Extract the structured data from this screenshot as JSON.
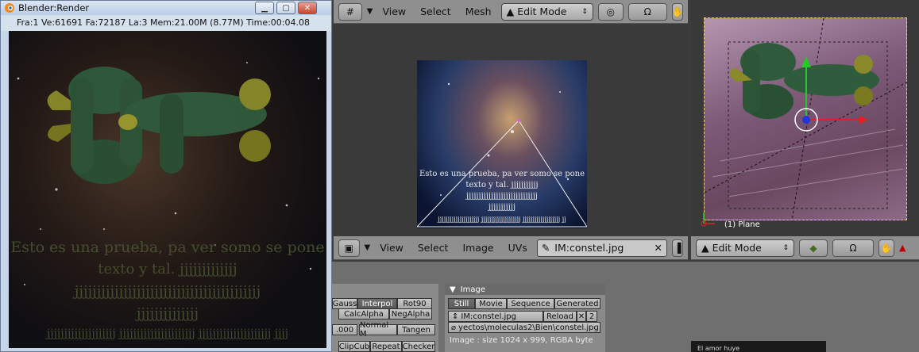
{
  "render_window": {
    "title": "Blender:Render",
    "info": "Fra:1  Ve:61691 Fa:72187 La:3 Mem:21.00M (8.77M) Time:00:04.08",
    "text_lines": [
      "Esto es una prueba, pa ver somo se pone",
      "texto y tal. jjjjjjjjjjjjj",
      "jjjjjjjjjjjjjjjjjjjjjjjjjjjjjjjjjjjjjjjjjj",
      "jjjjjjjjjjjjjj",
      "jjjjjjjjjjjjjjjjjjjj jjjjjjjjjjjjjjjjjjjjjj jjjjjjjjjjjjjjjjjjjjj jjjj"
    ]
  },
  "uv_header": {
    "menus": [
      "View",
      "Select",
      "Mesh"
    ],
    "mode": "Edit Mode"
  },
  "uv_image": {
    "text_lines": [
      "Esto es una prueba, pa ver somo se pone",
      "texto y tal. jjjjjjjjjjj",
      "jjjjjjjjjjjjjjjjjjjjjjjjjjjjj",
      "jjjjjjjjjjj",
      "jjjjjjjjjjjjjjjjjjjjj jjjjjjjjjjjjjjjjjjjj jjjjjjjjjjjjjjjjjjj jj"
    ]
  },
  "uv_footer": {
    "menus": [
      "View",
      "Select",
      "Image",
      "UVs"
    ],
    "image_name": "IM:constel.jpg"
  },
  "view3d": {
    "object_label": "(1) Plane",
    "mode": "Edit Mode"
  },
  "buttons_panel": {
    "left_buttons": [
      "Gauss",
      "Interpol",
      "Rot90",
      "CalcAlpha",
      "NegAlpha",
      ".000",
      "Normal M",
      "Tangen",
      "ClipCub",
      "Repeat",
      "Checker"
    ],
    "image_panel_title": "Image",
    "source_tabs": [
      "Still",
      "Movie",
      "Sequence",
      "Generated"
    ],
    "image_name": "IM:constel.jpg",
    "reload_label": "Reload",
    "users": "2",
    "filepath": "yectos\\moleculas2\\Bien\\constel.jpg",
    "image_info": "Image : size 1024 x 999, RGBA byte",
    "tooltip": "El amor huye"
  },
  "colors": {
    "header_gray": "#8f8f8f",
    "panel_gray": "#6f6f6f",
    "background": "#3c3c3c",
    "green_blob": "#2f5a3c",
    "yellow_lobe": "#8a8a2a"
  }
}
